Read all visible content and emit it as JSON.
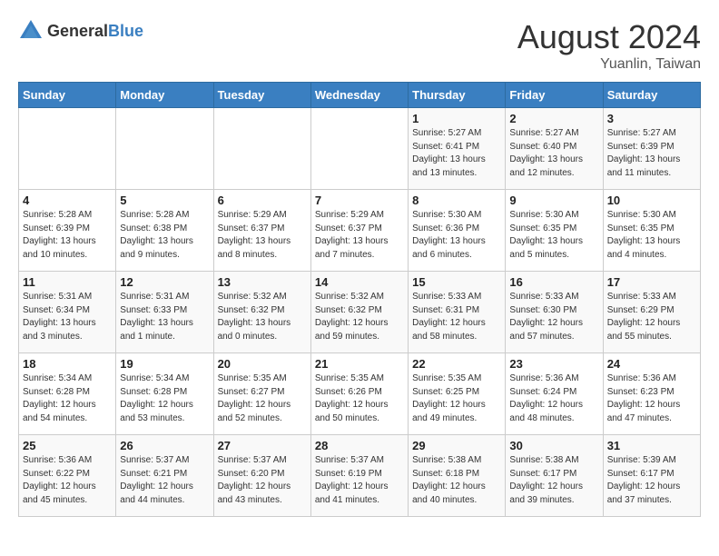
{
  "logo": {
    "general": "General",
    "blue": "Blue"
  },
  "title": "August 2024",
  "subtitle": "Yuanlin, Taiwan",
  "days_header": [
    "Sunday",
    "Monday",
    "Tuesday",
    "Wednesday",
    "Thursday",
    "Friday",
    "Saturday"
  ],
  "weeks": [
    [
      {
        "day": "",
        "info": ""
      },
      {
        "day": "",
        "info": ""
      },
      {
        "day": "",
        "info": ""
      },
      {
        "day": "",
        "info": ""
      },
      {
        "day": "1",
        "info": "Sunrise: 5:27 AM\nSunset: 6:41 PM\nDaylight: 13 hours\nand 13 minutes."
      },
      {
        "day": "2",
        "info": "Sunrise: 5:27 AM\nSunset: 6:40 PM\nDaylight: 13 hours\nand 12 minutes."
      },
      {
        "day": "3",
        "info": "Sunrise: 5:27 AM\nSunset: 6:39 PM\nDaylight: 13 hours\nand 11 minutes."
      }
    ],
    [
      {
        "day": "4",
        "info": "Sunrise: 5:28 AM\nSunset: 6:39 PM\nDaylight: 13 hours\nand 10 minutes."
      },
      {
        "day": "5",
        "info": "Sunrise: 5:28 AM\nSunset: 6:38 PM\nDaylight: 13 hours\nand 9 minutes."
      },
      {
        "day": "6",
        "info": "Sunrise: 5:29 AM\nSunset: 6:37 PM\nDaylight: 13 hours\nand 8 minutes."
      },
      {
        "day": "7",
        "info": "Sunrise: 5:29 AM\nSunset: 6:37 PM\nDaylight: 13 hours\nand 7 minutes."
      },
      {
        "day": "8",
        "info": "Sunrise: 5:30 AM\nSunset: 6:36 PM\nDaylight: 13 hours\nand 6 minutes."
      },
      {
        "day": "9",
        "info": "Sunrise: 5:30 AM\nSunset: 6:35 PM\nDaylight: 13 hours\nand 5 minutes."
      },
      {
        "day": "10",
        "info": "Sunrise: 5:30 AM\nSunset: 6:35 PM\nDaylight: 13 hours\nand 4 minutes."
      }
    ],
    [
      {
        "day": "11",
        "info": "Sunrise: 5:31 AM\nSunset: 6:34 PM\nDaylight: 13 hours\nand 3 minutes."
      },
      {
        "day": "12",
        "info": "Sunrise: 5:31 AM\nSunset: 6:33 PM\nDaylight: 13 hours\nand 1 minute."
      },
      {
        "day": "13",
        "info": "Sunrise: 5:32 AM\nSunset: 6:32 PM\nDaylight: 13 hours\nand 0 minutes."
      },
      {
        "day": "14",
        "info": "Sunrise: 5:32 AM\nSunset: 6:32 PM\nDaylight: 12 hours\nand 59 minutes."
      },
      {
        "day": "15",
        "info": "Sunrise: 5:33 AM\nSunset: 6:31 PM\nDaylight: 12 hours\nand 58 minutes."
      },
      {
        "day": "16",
        "info": "Sunrise: 5:33 AM\nSunset: 6:30 PM\nDaylight: 12 hours\nand 57 minutes."
      },
      {
        "day": "17",
        "info": "Sunrise: 5:33 AM\nSunset: 6:29 PM\nDaylight: 12 hours\nand 55 minutes."
      }
    ],
    [
      {
        "day": "18",
        "info": "Sunrise: 5:34 AM\nSunset: 6:28 PM\nDaylight: 12 hours\nand 54 minutes."
      },
      {
        "day": "19",
        "info": "Sunrise: 5:34 AM\nSunset: 6:28 PM\nDaylight: 12 hours\nand 53 minutes."
      },
      {
        "day": "20",
        "info": "Sunrise: 5:35 AM\nSunset: 6:27 PM\nDaylight: 12 hours\nand 52 minutes."
      },
      {
        "day": "21",
        "info": "Sunrise: 5:35 AM\nSunset: 6:26 PM\nDaylight: 12 hours\nand 50 minutes."
      },
      {
        "day": "22",
        "info": "Sunrise: 5:35 AM\nSunset: 6:25 PM\nDaylight: 12 hours\nand 49 minutes."
      },
      {
        "day": "23",
        "info": "Sunrise: 5:36 AM\nSunset: 6:24 PM\nDaylight: 12 hours\nand 48 minutes."
      },
      {
        "day": "24",
        "info": "Sunrise: 5:36 AM\nSunset: 6:23 PM\nDaylight: 12 hours\nand 47 minutes."
      }
    ],
    [
      {
        "day": "25",
        "info": "Sunrise: 5:36 AM\nSunset: 6:22 PM\nDaylight: 12 hours\nand 45 minutes."
      },
      {
        "day": "26",
        "info": "Sunrise: 5:37 AM\nSunset: 6:21 PM\nDaylight: 12 hours\nand 44 minutes."
      },
      {
        "day": "27",
        "info": "Sunrise: 5:37 AM\nSunset: 6:20 PM\nDaylight: 12 hours\nand 43 minutes."
      },
      {
        "day": "28",
        "info": "Sunrise: 5:37 AM\nSunset: 6:19 PM\nDaylight: 12 hours\nand 41 minutes."
      },
      {
        "day": "29",
        "info": "Sunrise: 5:38 AM\nSunset: 6:18 PM\nDaylight: 12 hours\nand 40 minutes."
      },
      {
        "day": "30",
        "info": "Sunrise: 5:38 AM\nSunset: 6:17 PM\nDaylight: 12 hours\nand 39 minutes."
      },
      {
        "day": "31",
        "info": "Sunrise: 5:39 AM\nSunset: 6:17 PM\nDaylight: 12 hours\nand 37 minutes."
      }
    ]
  ]
}
